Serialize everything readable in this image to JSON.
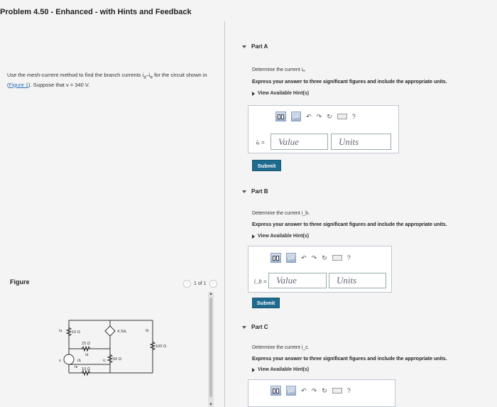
{
  "problem_title": "Problem 4.50 - Enhanced - with Hints and Feedback",
  "intro": {
    "text_before": "Use the mesh-current method to find the branch currents i",
    "sub_a": "a",
    "dash": "–i",
    "sub_e": "e",
    "text_mid": " for the circuit shown in (",
    "figure_link": "Figure 1",
    "text_after": "). Suppose that v = 340 V."
  },
  "figure": {
    "label": "Figure",
    "pager": "1 of 1",
    "resistor_labels": [
      "10 Ω",
      "25 Ω",
      "50 Ω",
      "10 Ω",
      "100 Ω"
    ],
    "source_label": "4.3iΔ",
    "voltage_label": "v",
    "delta_label": "iΔ",
    "currents": [
      "ia",
      "ib",
      "ic",
      "id",
      "ie"
    ]
  },
  "parts": [
    {
      "header": "Part A",
      "question": "Determine the current iₐ.",
      "instruction": "Express your answer to three significant figures and include the appropriate units.",
      "hint": "View Available Hint(s)",
      "var": "iₐ =",
      "value_placeholder": "Value",
      "units_placeholder": "Units",
      "submit": "Submit"
    },
    {
      "header": "Part B",
      "question": "Determine the current i_b.",
      "instruction": "Express your answer to three significant figures and include the appropriate units.",
      "hint": "View Available Hint(s)",
      "var": "i_b =",
      "value_placeholder": "Value",
      "units_placeholder": "Units",
      "submit": "Submit"
    },
    {
      "header": "Part C",
      "question": "Determine the current i_c.",
      "instruction": "Express your answer to three significant figures and include the appropriate units.",
      "hint": "View Available Hint(s)"
    }
  ],
  "toolbar": {
    "mu_label": "μA",
    "help": "?"
  }
}
